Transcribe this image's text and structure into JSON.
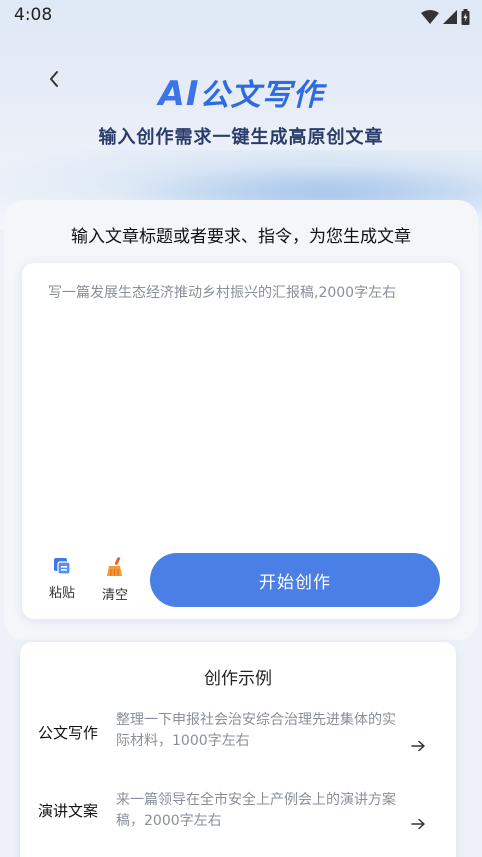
{
  "status": {
    "time": "4:08"
  },
  "header": {
    "title_ai": "AI",
    "title_rest": "公文写作",
    "subtitle": "输入创作需求一键生成高原创文章"
  },
  "main": {
    "prompt_heading": "输入文章标题或者要求、指令，为您生成文章",
    "input_placeholder": "写一篇发展生态经济推动乡村振兴的汇报稿,2000字左右",
    "paste_label": "粘贴",
    "clear_label": "清空",
    "start_label": "开始创作"
  },
  "examples": {
    "title": "创作示例",
    "items": [
      {
        "category": "公文写作",
        "text": "整理一下申报社会治安综合治理先进集体的实际材料，1000字左右"
      },
      {
        "category": "演讲文案",
        "text": "来一篇领导在全市安全上产例会上的演讲方案稿，2000字左右"
      }
    ]
  },
  "colors": {
    "accent": "#4a7fe6",
    "title_blue": "#2f6be0",
    "clear_icon_orange": "#f08a2c"
  }
}
